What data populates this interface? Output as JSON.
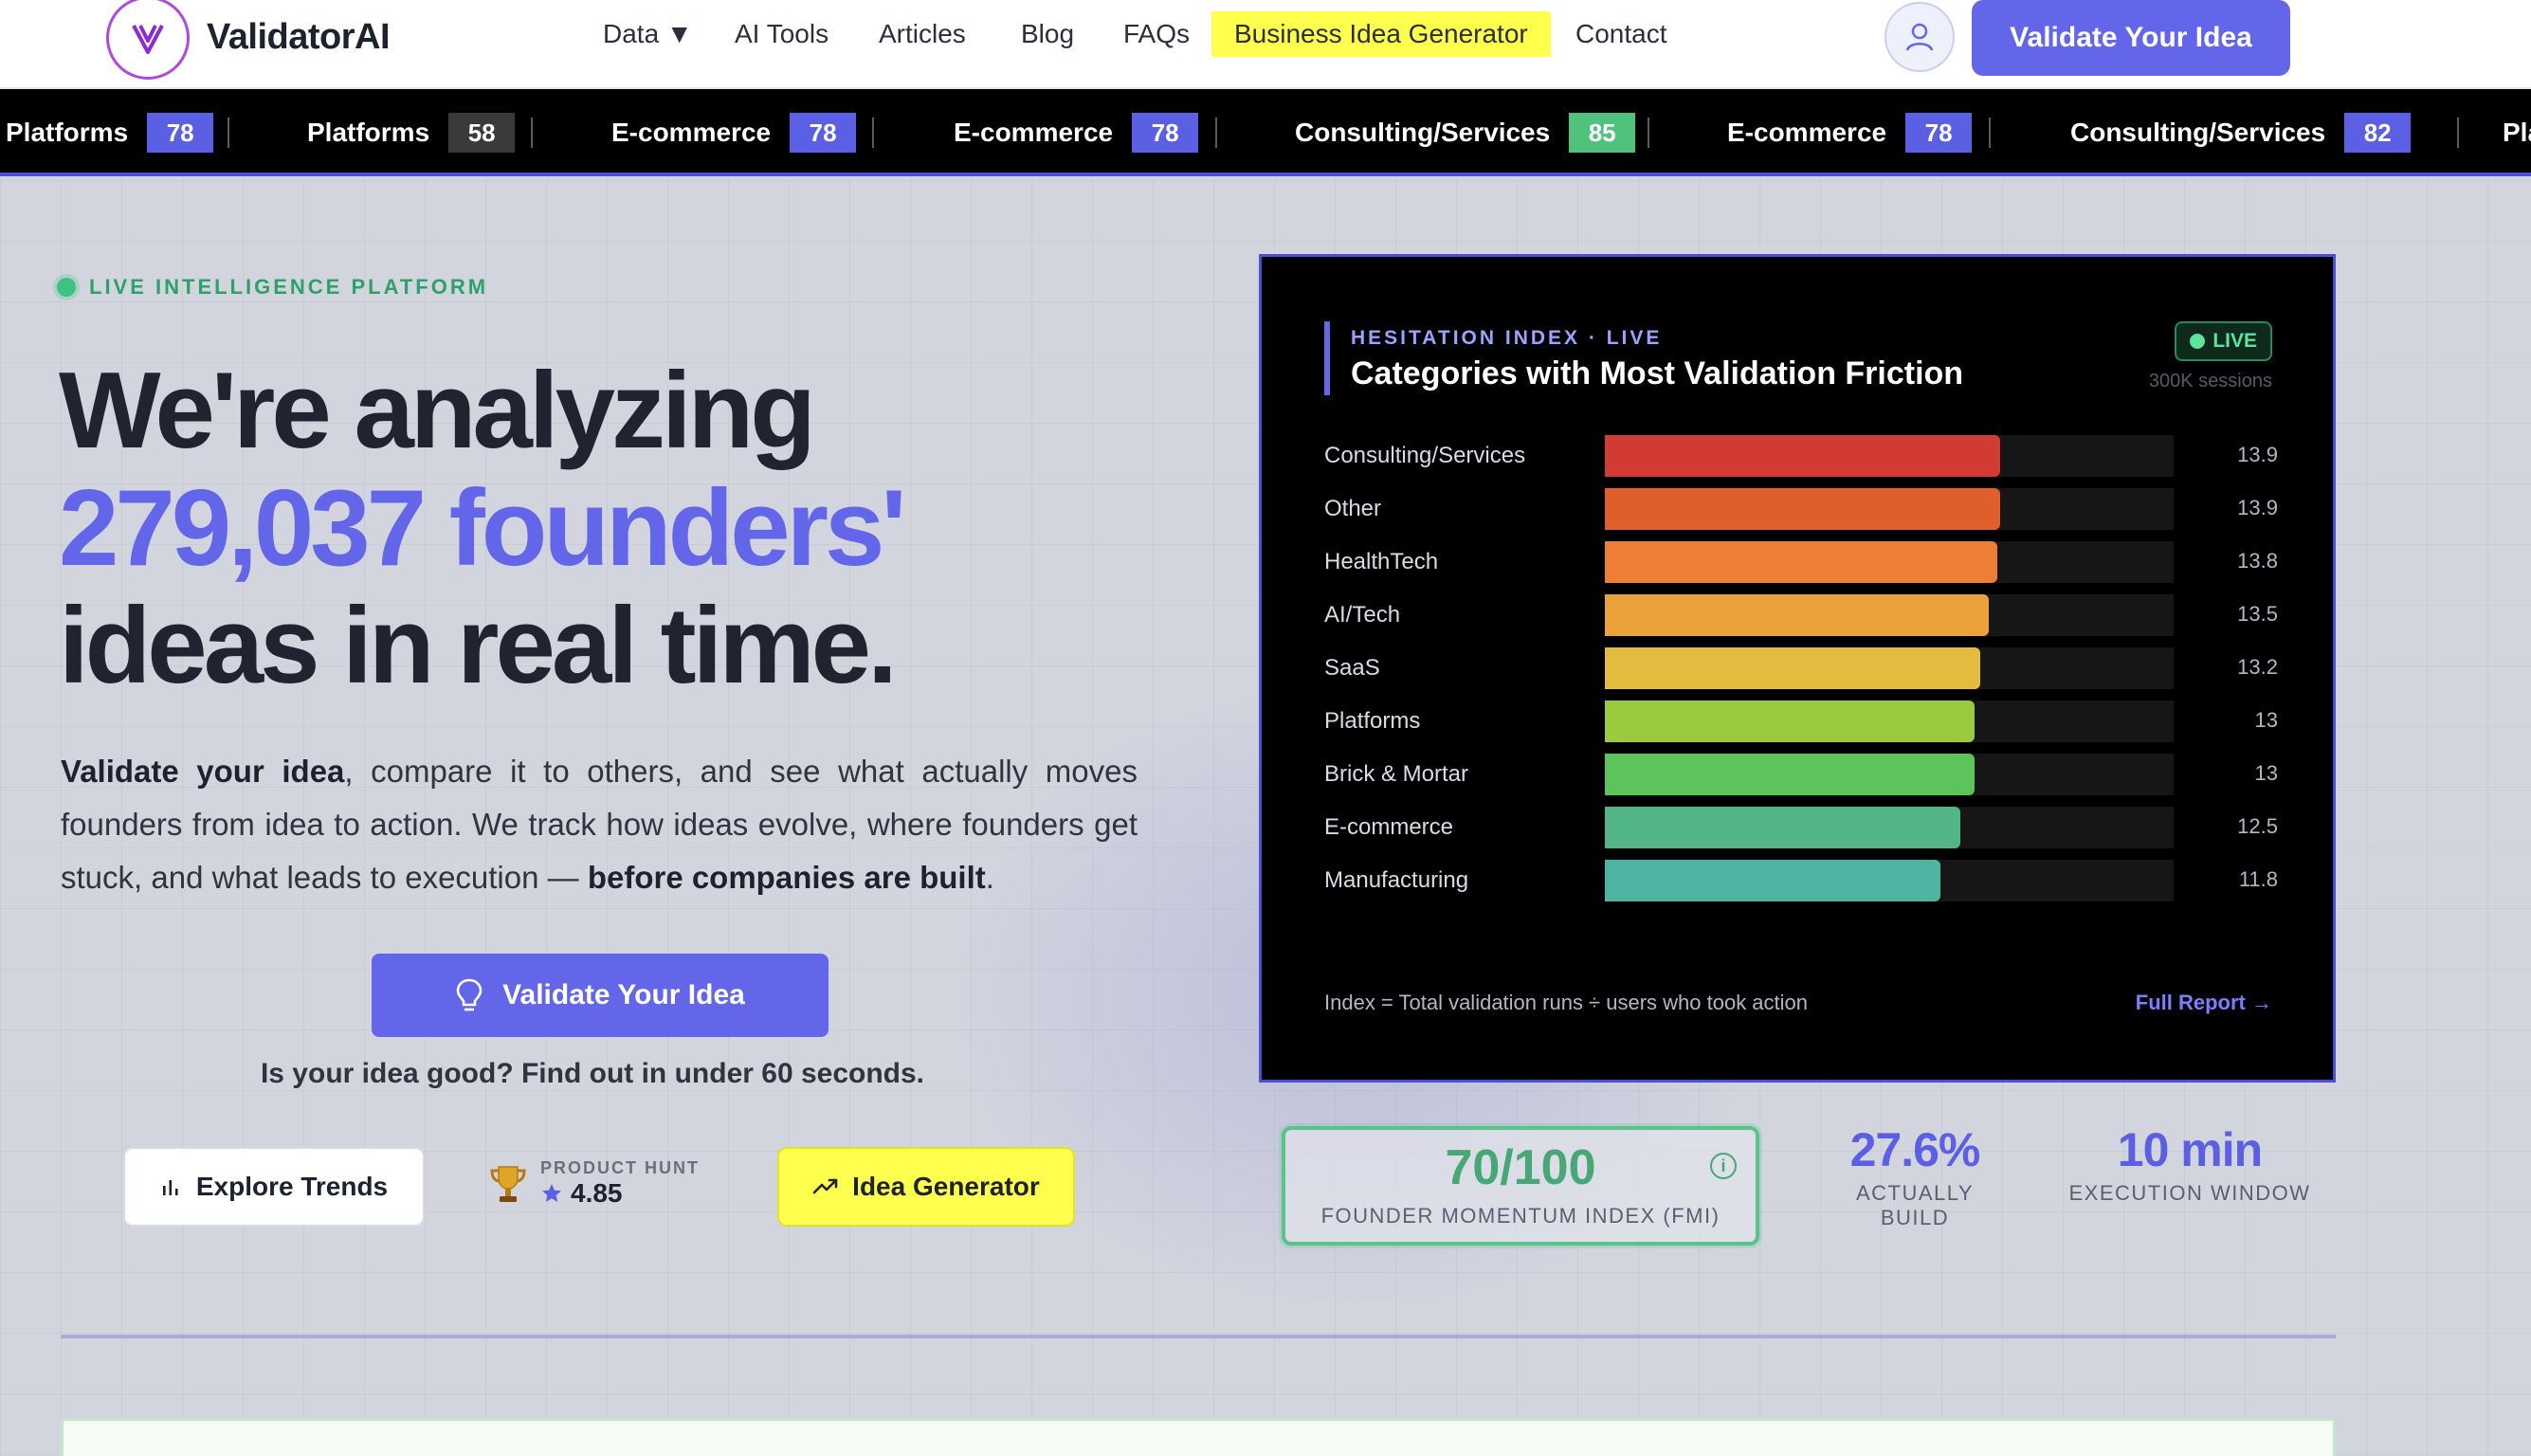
{
  "brand": {
    "name": "ValidatorAI",
    "accent": "#6366e8"
  },
  "nav": {
    "links": [
      "Data ▼",
      "AI Tools",
      "Articles",
      "Blog",
      "FAQs",
      "Business Idea Generator",
      "Contact"
    ],
    "cta": "Validate Your Idea"
  },
  "ticker": [
    {
      "label": "Platforms",
      "score": "78",
      "color": "#5b5fe3"
    },
    {
      "label": "Platforms",
      "score": "58",
      "color": "#3a3a3a"
    },
    {
      "label": "E-commerce",
      "score": "78",
      "color": "#5b5fe3"
    },
    {
      "label": "E-commerce",
      "score": "78",
      "color": "#5b5fe3"
    },
    {
      "label": "Consulting/Services",
      "score": "85",
      "color": "#4fc27e"
    },
    {
      "label": "E-commerce",
      "score": "78",
      "color": "#5b5fe3"
    },
    {
      "label": "Consulting/Services",
      "score": "82",
      "color": "#5b5fe3"
    },
    {
      "label": "Pla",
      "score": "",
      "color": "#5b5fe3"
    }
  ],
  "hero": {
    "tag": "LIVE INTELLIGENCE PLATFORM",
    "line1": "We're analyzing",
    "line2": "279,037 founders'",
    "line3": "ideas in real time.",
    "lead_strong1": "Validate your idea",
    "lead_mid": ", compare it to others, and see what actually moves founders from idea to action. We track how ideas evolve, where founders get stuck, and what leads to execution — ",
    "lead_strong2": "before companies are built",
    "lead_end": ".",
    "cta": "Validate Your Idea",
    "tagline": "Is your idea good? Find out in under 60 seconds.",
    "explore": "Explore Trends",
    "ph_label": "PRODUCT HUNT",
    "ph_rating": "4.85",
    "generator": "Idea Generator"
  },
  "panel": {
    "kicker": "HESITATION INDEX · LIVE",
    "title": "Categories with Most Validation Friction",
    "live": "LIVE",
    "sessions": "300K sessions",
    "footnote": "Index = Total validation runs ÷ users who took action",
    "link": "Full Report →"
  },
  "chart_data": {
    "type": "bar",
    "orientation": "horizontal",
    "title": "Categories with Most Validation Friction",
    "categories": [
      "Consulting/Services",
      "Other",
      "HealthTech",
      "AI/Tech",
      "SaaS",
      "Platforms",
      "Brick & Mortar",
      "E-commerce",
      "Manufacturing"
    ],
    "values": [
      13.9,
      13.9,
      13.8,
      13.5,
      13.2,
      13,
      13,
      12.5,
      11.8
    ],
    "value_labels": [
      "13.9",
      "13.9",
      "13.8",
      "13.5",
      "13.2",
      "13",
      "13",
      "12.5",
      "11.8"
    ],
    "colors": [
      "#d13b33",
      "#df5f2b",
      "#ec7f35",
      "#eba23a",
      "#e3bb3f",
      "#9acb3f",
      "#5cc45a",
      "#52b585",
      "#4fb5a3"
    ],
    "xlim": [
      0,
      20
    ],
    "grid": false
  },
  "stats": {
    "fmi_value": "70/100",
    "fmi_label": "FOUNDER MOMENTUM INDEX (FMI)",
    "build_value": "27.6%",
    "build_label": "ACTUALLY BUILD",
    "window_value": "10 min",
    "window_label": "EXECUTION WINDOW"
  }
}
